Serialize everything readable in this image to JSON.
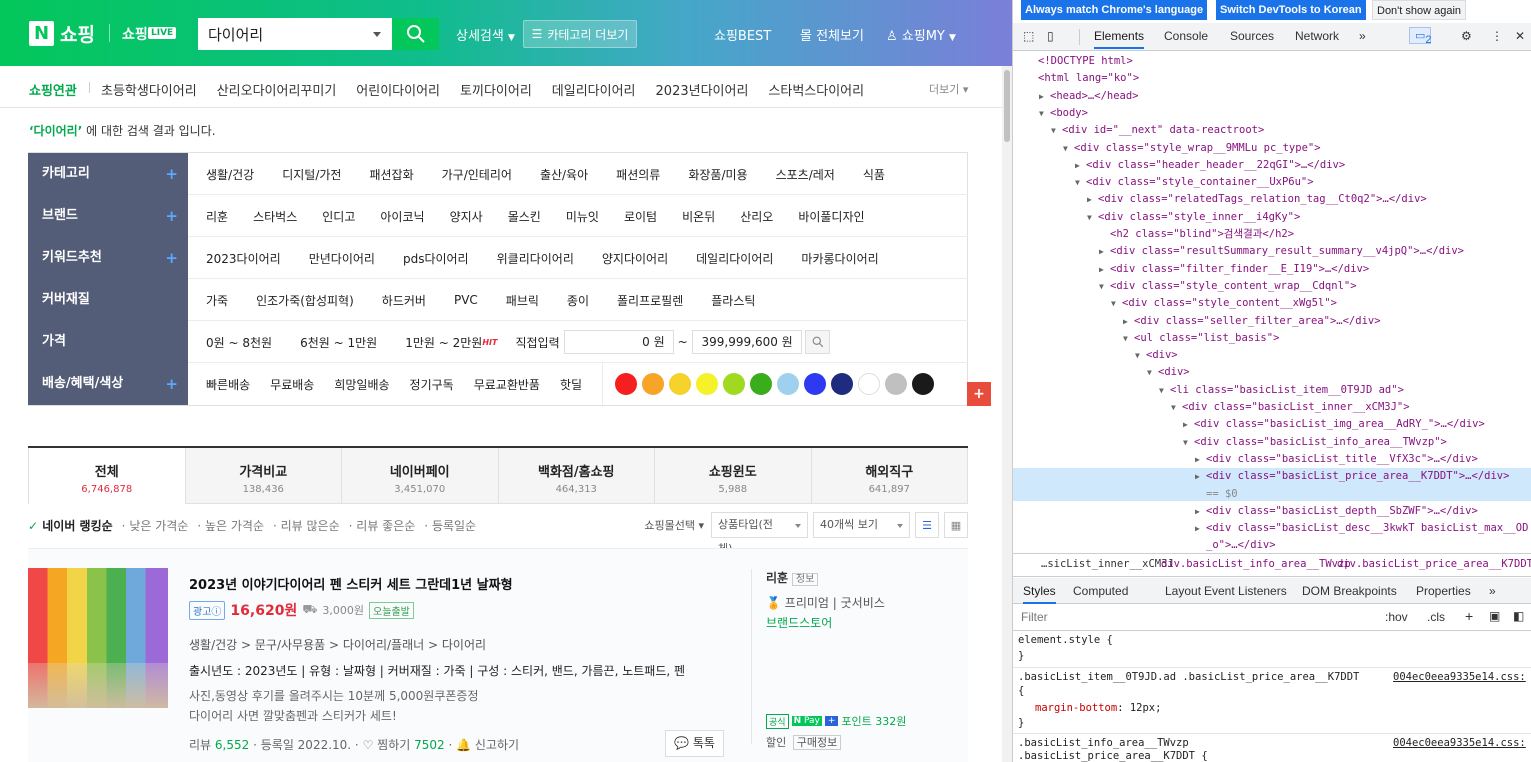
{
  "header": {
    "logo_n": "N",
    "logo_text": "쇼핑",
    "live_text": "쇼핑",
    "live_badge": "LIVE",
    "search_value": "다이어리",
    "detail_search": "상세검색",
    "category_more": "카테고리 더보기",
    "best": "쇼핑BEST",
    "all_malls": "몰 전체보기",
    "my": "쇼핑MY"
  },
  "related": {
    "title": "쇼핑연관",
    "items": [
      "초등학생다이어리",
      "산리오다이어리꾸미기",
      "어린이다이어리",
      "토끼다이어리",
      "데일리다이어리",
      "2023년다이어리",
      "스타벅스다이어리"
    ],
    "more": "더보기"
  },
  "summary": {
    "keyword": "‘다이어리’",
    "text": " 에 대한 검색 결과 입니다."
  },
  "filters": [
    {
      "label": "카테고리",
      "plus": true,
      "items": [
        "생활/건강",
        "디지털/가전",
        "패션잡화",
        "가구/인테리어",
        "출산/육아",
        "패션의류",
        "화장품/미용",
        "스포츠/레저",
        "식품"
      ]
    },
    {
      "label": "브랜드",
      "plus": true,
      "items": [
        "리훈",
        "스타벅스",
        "인디고",
        "아이코닉",
        "양지사",
        "몰스킨",
        "미뉴잇",
        "로이텀",
        "비온뒤",
        "산리오",
        "바이풀디자인"
      ]
    },
    {
      "label": "키워드추천",
      "plus": true,
      "items": [
        "2023다이어리",
        "만년다이어리",
        "pds다이어리",
        "위클리다이어리",
        "양지다이어리",
        "데일리다이어리",
        "마카롱다이어리"
      ]
    },
    {
      "label": "커버재질",
      "plus": false,
      "items": [
        "가죽",
        "인조가죽(합성피혁)",
        "하드커버",
        "PVC",
        "패브릭",
        "종이",
        "폴리프로필렌",
        "플라스틱"
      ]
    },
    {
      "label": "가격",
      "plus": false,
      "items": [
        "0원 ~ 8천원",
        "6천원 ~ 1만원",
        "1만원 ~ 2만원"
      ],
      "hit": "HIT",
      "direct": "직접입력",
      "min_ph": "0 원",
      "max_ph": "399,999,600 원",
      "tilde": "~"
    },
    {
      "label": "배송/혜택/색상",
      "plus": true,
      "items": [
        "빠른배송",
        "무료배송",
        "희망일배송",
        "정기구독",
        "무료교환반품",
        "핫딜"
      ]
    }
  ],
  "colors": [
    "#f51f1f",
    "#f7a428",
    "#f4d22a",
    "#f5f12a",
    "#9fd920",
    "#3aad1c",
    "#9fd1ee",
    "#2d3af2",
    "#1e2b7e",
    "#ffffff",
    "#c0c0c0",
    "#1a1a1a"
  ],
  "tabs": [
    {
      "name": "전체",
      "count": "6,746,878"
    },
    {
      "name": "가격비교",
      "count": "138,436"
    },
    {
      "name": "네이버페이",
      "count": "3,451,070"
    },
    {
      "name": "백화점/홈쇼핑",
      "count": "464,313"
    },
    {
      "name": "쇼핑윈도",
      "count": "5,988"
    },
    {
      "name": "해외직구",
      "count": "641,897"
    }
  ],
  "sort": {
    "options": [
      "네이버 랭킹순",
      "낮은 가격순",
      "높은 가격순",
      "리뷰 많은순",
      "리뷰 좋은순",
      "등록일순"
    ],
    "mall_select": "쇼핑몰선택",
    "product_type": "상품타입(전체)",
    "per_page": "40개씩 보기"
  },
  "item": {
    "title": "2023년 이야기다이어리 펜 스티커 세트 그란데1년 날짜형",
    "ad": "광고ⓘ",
    "price": "16,620원",
    "shipping": "3,000원",
    "today": "오늘출발",
    "category": "생활/건강 > 문구/사무용품 > 다이어리/플래너 > 다이어리",
    "spec": "출시년도 : 2023년도  |  유형 : 날짜형  |  커버재질 : 가죽  |  구성 : 스티커, 밴드, 가름끈, 노트패드, 펜",
    "desc1": "사진,동영상 후기를 올려주시는 10분께 5,000원쿠폰증정",
    "desc2": "다이어리 사면 깔맞춤펜과 스티커가 세트!",
    "review_label": "리뷰",
    "review_count": "6,552",
    "reg": "등록일 2022.10.",
    "zzim_label": "찜하기",
    "zzim_count": "7502",
    "report": "신고하기",
    "talk": "톡톡",
    "seller": "리훈",
    "seller_info": "정보",
    "premium": "프리미엄",
    "goodservice": "굿서비스",
    "brandstore": "브랜드스토어",
    "official": "공식",
    "npay": "Pay",
    "point": "포인트 332원",
    "discount": "할인",
    "buyinfo": "구매정보"
  },
  "devtools": {
    "bar": [
      "Always match Chrome's language",
      "Switch DevTools to Korean",
      "Don't show again"
    ],
    "tabs": [
      "Elements",
      "Console",
      "Sources",
      "Network"
    ],
    "issues": "2",
    "dom": [
      {
        "indent": 0,
        "tri": "",
        "html": "<!DOCTYPE html>"
      },
      {
        "indent": 0,
        "tri": "",
        "html": "<html lang=\"ko\">"
      },
      {
        "indent": 1,
        "tri": "▶",
        "html": "<head>…</head>"
      },
      {
        "indent": 1,
        "tri": "▼",
        "html": "<body>"
      },
      {
        "indent": 2,
        "tri": "▼",
        "html": "<div id=\"__next\" data-reactroot>"
      },
      {
        "indent": 3,
        "tri": "▼",
        "html": "<div class=\"style_wrap__9MMLu pc_type\">"
      },
      {
        "indent": 4,
        "tri": "▶",
        "html": "<div class=\"header_header__22qGI\">…</div>"
      },
      {
        "indent": 4,
        "tri": "▼",
        "html": "<div class=\"style_container__UxP6u\">"
      },
      {
        "indent": 5,
        "tri": "▶",
        "html": "<div class=\"relatedTags_relation_tag__Ct0q2\">…</div>"
      },
      {
        "indent": 5,
        "tri": "▼",
        "html": "<div class=\"style_inner__i4gKy\">"
      },
      {
        "indent": 6,
        "tri": "",
        "html": "<h2 class=\"blind\">검색결과</h2>"
      },
      {
        "indent": 6,
        "tri": "▶",
        "html": "<div class=\"resultSummary_result_summary__v4jpQ\">…</div>"
      },
      {
        "indent": 6,
        "tri": "▶",
        "html": "<div class=\"filter_finder__E_I19\">…</div>"
      },
      {
        "indent": 6,
        "tri": "▼",
        "html": "<div class=\"style_content_wrap__Cdqnl\">"
      },
      {
        "indent": 7,
        "tri": "▼",
        "html": "<div class=\"style_content__xWg5l\">"
      },
      {
        "indent": 8,
        "tri": "▶",
        "html": "<div class=\"seller_filter_area\">…</div>"
      },
      {
        "indent": 8,
        "tri": "▼",
        "html": "<ul class=\"list_basis\">"
      },
      {
        "indent": 9,
        "tri": "▼",
        "html": "<div>"
      },
      {
        "indent": 10,
        "tri": "▼",
        "html": "<div>"
      },
      {
        "indent": 11,
        "tri": "▼",
        "html": "<li class=\"basicList_item__0T9JD ad\">"
      },
      {
        "indent": 12,
        "tri": "▼",
        "html": "<div class=\"basicList_inner__xCM3J\">"
      },
      {
        "indent": 13,
        "tri": "▶",
        "html": "<div class=\"basicList_img_area__AdRY_\">…</div>"
      },
      {
        "indent": 13,
        "tri": "▼",
        "html": "<div class=\"basicList_info_area__TWvzp\">"
      },
      {
        "indent": 14,
        "tri": "▶",
        "html": "<div class=\"basicList_title__VfX3c\">…</div>"
      },
      {
        "indent": 14,
        "tri": "▶",
        "html": "<div class=\"basicList_price_area__K7DDT\">…</div>"
      },
      {
        "indent": 14,
        "tri": "",
        "html": "== $0"
      },
      {
        "indent": 14,
        "tri": "▶",
        "html": "<div class=\"basicList_depth__SbZWF\">…</div>"
      },
      {
        "indent": 14,
        "tri": "▶",
        "html": "<div class=\"basicList_desc__3kwkT basicList_max__OD"
      },
      {
        "indent": 14,
        "tri": "",
        "html": "_o\">…</div>"
      }
    ],
    "breadcrumb": [
      "…sicList_inner__xCM3J",
      "div.basicList_info_area__TWvzp",
      "div.basicList_price_area__K7DDT"
    ],
    "style_tabs": [
      "Styles",
      "Computed",
      "Layout",
      "Event Listeners",
      "DOM Breakpoints",
      "Properties"
    ],
    "filter_ph": "Filter",
    "hov": ":hov",
    "cls": ".cls",
    "rule1_sel": "element.style {",
    "rule1_end": "}",
    "rule2_sel": ".basicList_item__0T9JD.ad .basicList_price_area__K7DDT",
    "rule2_src": "004ec0eea9335e14.css:",
    "rule2_open": "{",
    "rule2_prop": "margin-bottom",
    "rule2_val": "12px;",
    "rule2_end": "}",
    "rule3_sel1": ".basicList_info_area__TWvzp",
    "rule3_sel2": ".basicList_price_area__K7DDT {",
    "rule3_src": "004ec0eea9335e14.css:"
  }
}
